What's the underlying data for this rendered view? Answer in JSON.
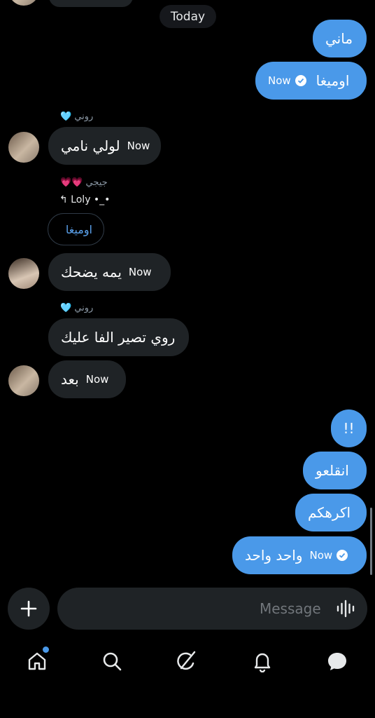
{
  "divider": {
    "today": "Today"
  },
  "messages": [
    {
      "id": "m1",
      "side": "out",
      "text": "ماني",
      "time": ""
    },
    {
      "id": "m2",
      "side": "out",
      "text": "اوميغا",
      "time": "Now"
    },
    {
      "id": "m3",
      "side": "in",
      "sender": "روني 🩵",
      "text": "لولي نامي",
      "time": "Now"
    },
    {
      "id": "m4",
      "side": "in",
      "sender": "جيجي 💗💗",
      "reply_to": "↰ Loly •_•",
      "quoted": "اوميغا",
      "text": "يمه يضحك",
      "time": "Now"
    },
    {
      "id": "m5",
      "side": "in",
      "sender": "روني 🩵",
      "text": "روي تصير الفا عليك",
      "time": ""
    },
    {
      "id": "m6",
      "side": "in",
      "text": "بعد",
      "time": "Now"
    },
    {
      "id": "m7",
      "side": "out",
      "text": "!!",
      "time": ""
    },
    {
      "id": "m8",
      "side": "out",
      "text": "انقلعو",
      "time": ""
    },
    {
      "id": "m9",
      "side": "out",
      "text": "اكرهكم",
      "time": ""
    },
    {
      "id": "m10",
      "side": "out",
      "text": "واحد واحد",
      "time": "Now"
    }
  ],
  "composer": {
    "placeholder": "Message"
  },
  "nav": {
    "items": [
      {
        "name": "home",
        "icon": "home-icon",
        "badge": true
      },
      {
        "name": "search",
        "icon": "search-icon"
      },
      {
        "name": "grok",
        "icon": "grok-icon"
      },
      {
        "name": "notifications",
        "icon": "bell-icon"
      },
      {
        "name": "messages",
        "icon": "messages-icon"
      }
    ]
  },
  "colors": {
    "accent": "#4a99e9",
    "incoming": "#1f2326",
    "background": "#000000"
  }
}
